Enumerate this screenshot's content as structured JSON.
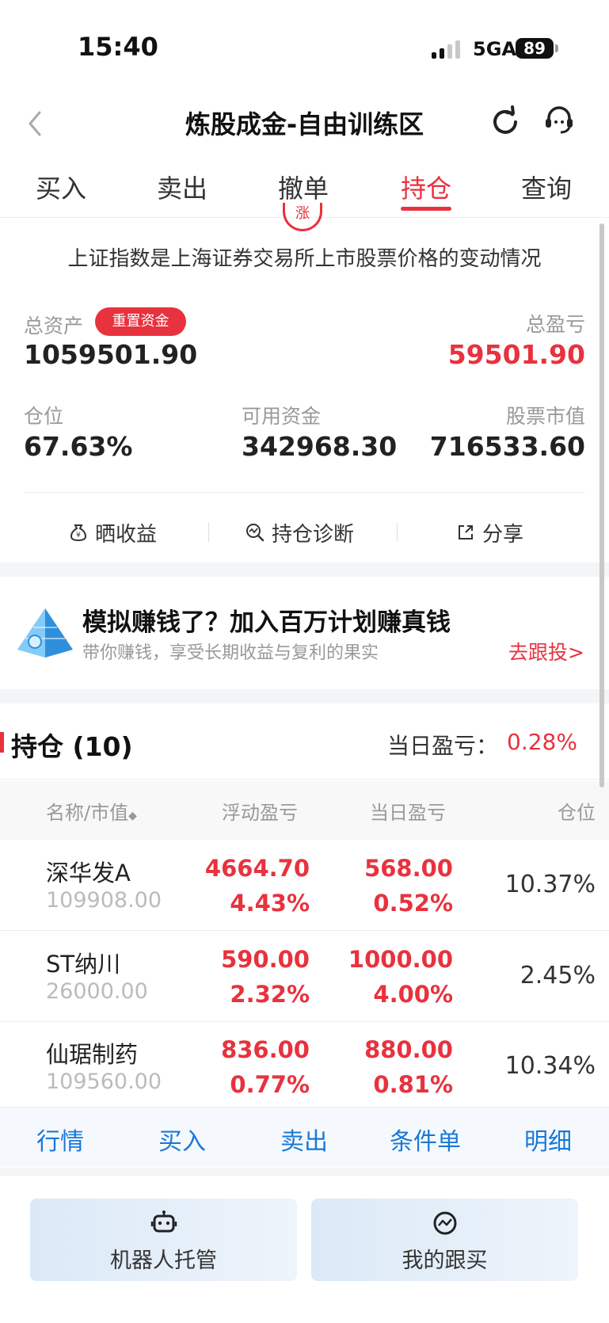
{
  "status_bar": {
    "time": "15:40",
    "network": "5GA",
    "battery": "89"
  },
  "nav": {
    "title": "炼股成金-自由训练区"
  },
  "tabs": [
    {
      "label": "买入"
    },
    {
      "label": "卖出"
    },
    {
      "label": "撤单"
    },
    {
      "label": "持仓",
      "active": true
    },
    {
      "label": "查询"
    }
  ],
  "notice": {
    "stamp": "涨",
    "text": "上证指数是上海证券交易所上市股票价格的变动情况"
  },
  "assets": {
    "total_assets_label": "总资产",
    "reset_button": "重置资金",
    "total_assets_value": "1059501.90",
    "total_pnl_label": "总盈亏",
    "total_pnl_value": "59501.90",
    "position_label": "仓位",
    "position_value": "67.63%",
    "available_label": "可用资金",
    "available_value": "342968.30",
    "market_value_label": "股票市值",
    "market_value_value": "716533.60"
  },
  "actions": {
    "show_profit": "晒收益",
    "diagnosis": "持仓诊断",
    "share": "分享"
  },
  "promo": {
    "title": "模拟赚钱了？加入百万计划赚真钱",
    "subtitle": "带你赚钱，享受长期收益与复利的果实",
    "link": "去跟投>"
  },
  "positions": {
    "title": "持仓 (10)",
    "daily_pnl_label": "当日盈亏：",
    "daily_pnl_value": "0.28%",
    "columns": {
      "name": "名称/市值",
      "float_pnl": "浮动盈亏",
      "daily_pnl": "当日盈亏",
      "position": "仓位"
    },
    "rows": [
      {
        "name": "深华发A",
        "market_value": "109908.00",
        "float_pnl": "4664.70",
        "float_pct": "4.43%",
        "daily_pnl": "568.00",
        "daily_pct": "0.52%",
        "position": "10.37%"
      },
      {
        "name": "ST纳川",
        "market_value": "26000.00",
        "float_pnl": "590.00",
        "float_pct": "2.32%",
        "daily_pnl": "1000.00",
        "daily_pct": "4.00%",
        "position": "2.45%"
      },
      {
        "name": "仙琚制药",
        "market_value": "109560.00",
        "float_pnl": "836.00",
        "float_pct": "0.77%",
        "daily_pnl": "880.00",
        "daily_pct": "0.81%",
        "position": "10.34%"
      }
    ]
  },
  "bottom_actions": [
    "行情",
    "买入",
    "卖出",
    "条件单",
    "明细"
  ],
  "footer": {
    "robot_label": "机器人托管",
    "follow_label": "我的跟买"
  },
  "colors": {
    "accent_red": "#e8323e",
    "link_blue": "#1a78d6"
  }
}
